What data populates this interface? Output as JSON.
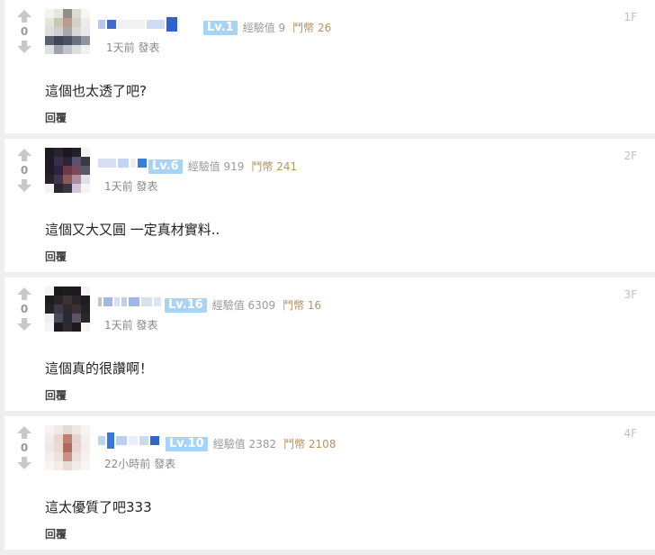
{
  "comments": [
    {
      "vote_count": "0",
      "level": "Lv.1",
      "exp": "經驗值 9",
      "coins": "鬥幣 26",
      "time": "1天前 發表",
      "floor": "1F",
      "text": "這個也太透了吧?",
      "reply": "回覆"
    },
    {
      "vote_count": "0",
      "level": "Lv.6",
      "exp": "經驗值 919",
      "coins": "鬥幣 241",
      "time": "1天前 發表",
      "floor": "2F",
      "text": "這個又大又圓 一定真材實料..",
      "reply": "回覆"
    },
    {
      "vote_count": "0",
      "level": "Lv.16",
      "exp": "經驗值 6309",
      "coins": "鬥幣 16",
      "time": "1天前 發表",
      "floor": "3F",
      "text": "這個真的很讚啊！",
      "reply": "回覆"
    },
    {
      "vote_count": "0",
      "level": "Lv.10",
      "exp": "經驗值 2382",
      "coins": "鬥幣 2108",
      "time": "22小時前 發表",
      "floor": "4F",
      "text": "這太優質了吧333",
      "reply": "回覆"
    }
  ],
  "colors": {
    "level_badge": "#a7d3f6",
    "coins": "#b59363",
    "meta": "#999999"
  }
}
